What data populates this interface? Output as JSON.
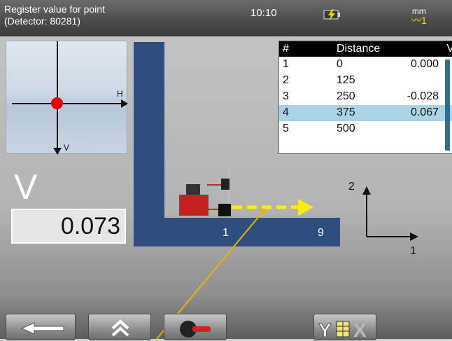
{
  "header": {
    "title_line1": "Register value for point",
    "title_line2": "(Detector: 80281)",
    "time": "10:10",
    "unit": "mm",
    "unit_sub": "1"
  },
  "crosshair": {
    "h_label": "H",
    "v_label": "V"
  },
  "reading": {
    "axis_label": "V",
    "value": "0.073"
  },
  "beam": {
    "label_left": "1",
    "label_right": "9"
  },
  "table": {
    "headers": [
      "#",
      "Distance",
      "V"
    ],
    "rows": [
      {
        "n": "1",
        "distance": "0",
        "v": "0.000"
      },
      {
        "n": "2",
        "distance": "125",
        "v": ""
      },
      {
        "n": "3",
        "distance": "250",
        "v": "-0.028"
      },
      {
        "n": "4",
        "distance": "375",
        "v": "0.067"
      },
      {
        "n": "5",
        "distance": "500",
        "v": ""
      }
    ],
    "selected_row": 3
  },
  "axes": {
    "y_label": "2",
    "x_label": "1"
  },
  "toolbar": {
    "buttons": [
      "back-arrow-icon",
      "expand-up-icon",
      "laser-toggle-icon",
      "y-table-x-icon"
    ]
  },
  "colors": {
    "beam": "#2e4f7e",
    "laser": "#ffee00",
    "point": "#e00000",
    "selected": "#a9d4e6"
  }
}
